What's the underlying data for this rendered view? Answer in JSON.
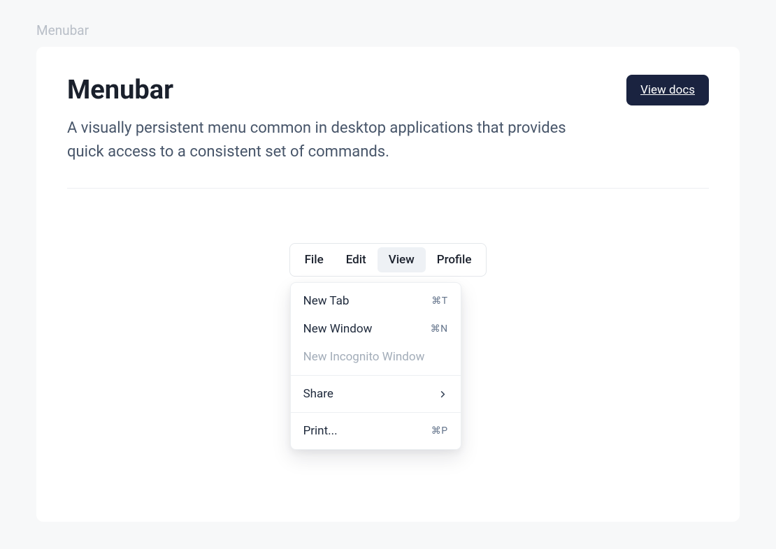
{
  "page_label": "Menubar",
  "header": {
    "title": "Menubar",
    "description": "A visually persistent menu common in desktop applications that provides quick access to a consistent set of commands.",
    "docs_button": "View docs"
  },
  "menubar": {
    "triggers": {
      "file": "File",
      "edit": "Edit",
      "view": "View",
      "profile": "Profile"
    },
    "active_trigger": "view"
  },
  "dropdown": {
    "items": [
      {
        "label": "New Tab",
        "shortcut": "⌘T"
      },
      {
        "label": "New Window",
        "shortcut": "⌘N"
      },
      {
        "label": "New Incognito Window",
        "disabled": true
      }
    ],
    "share": {
      "label": "Share"
    },
    "print": {
      "label": "Print...",
      "shortcut": "⌘P"
    }
  }
}
